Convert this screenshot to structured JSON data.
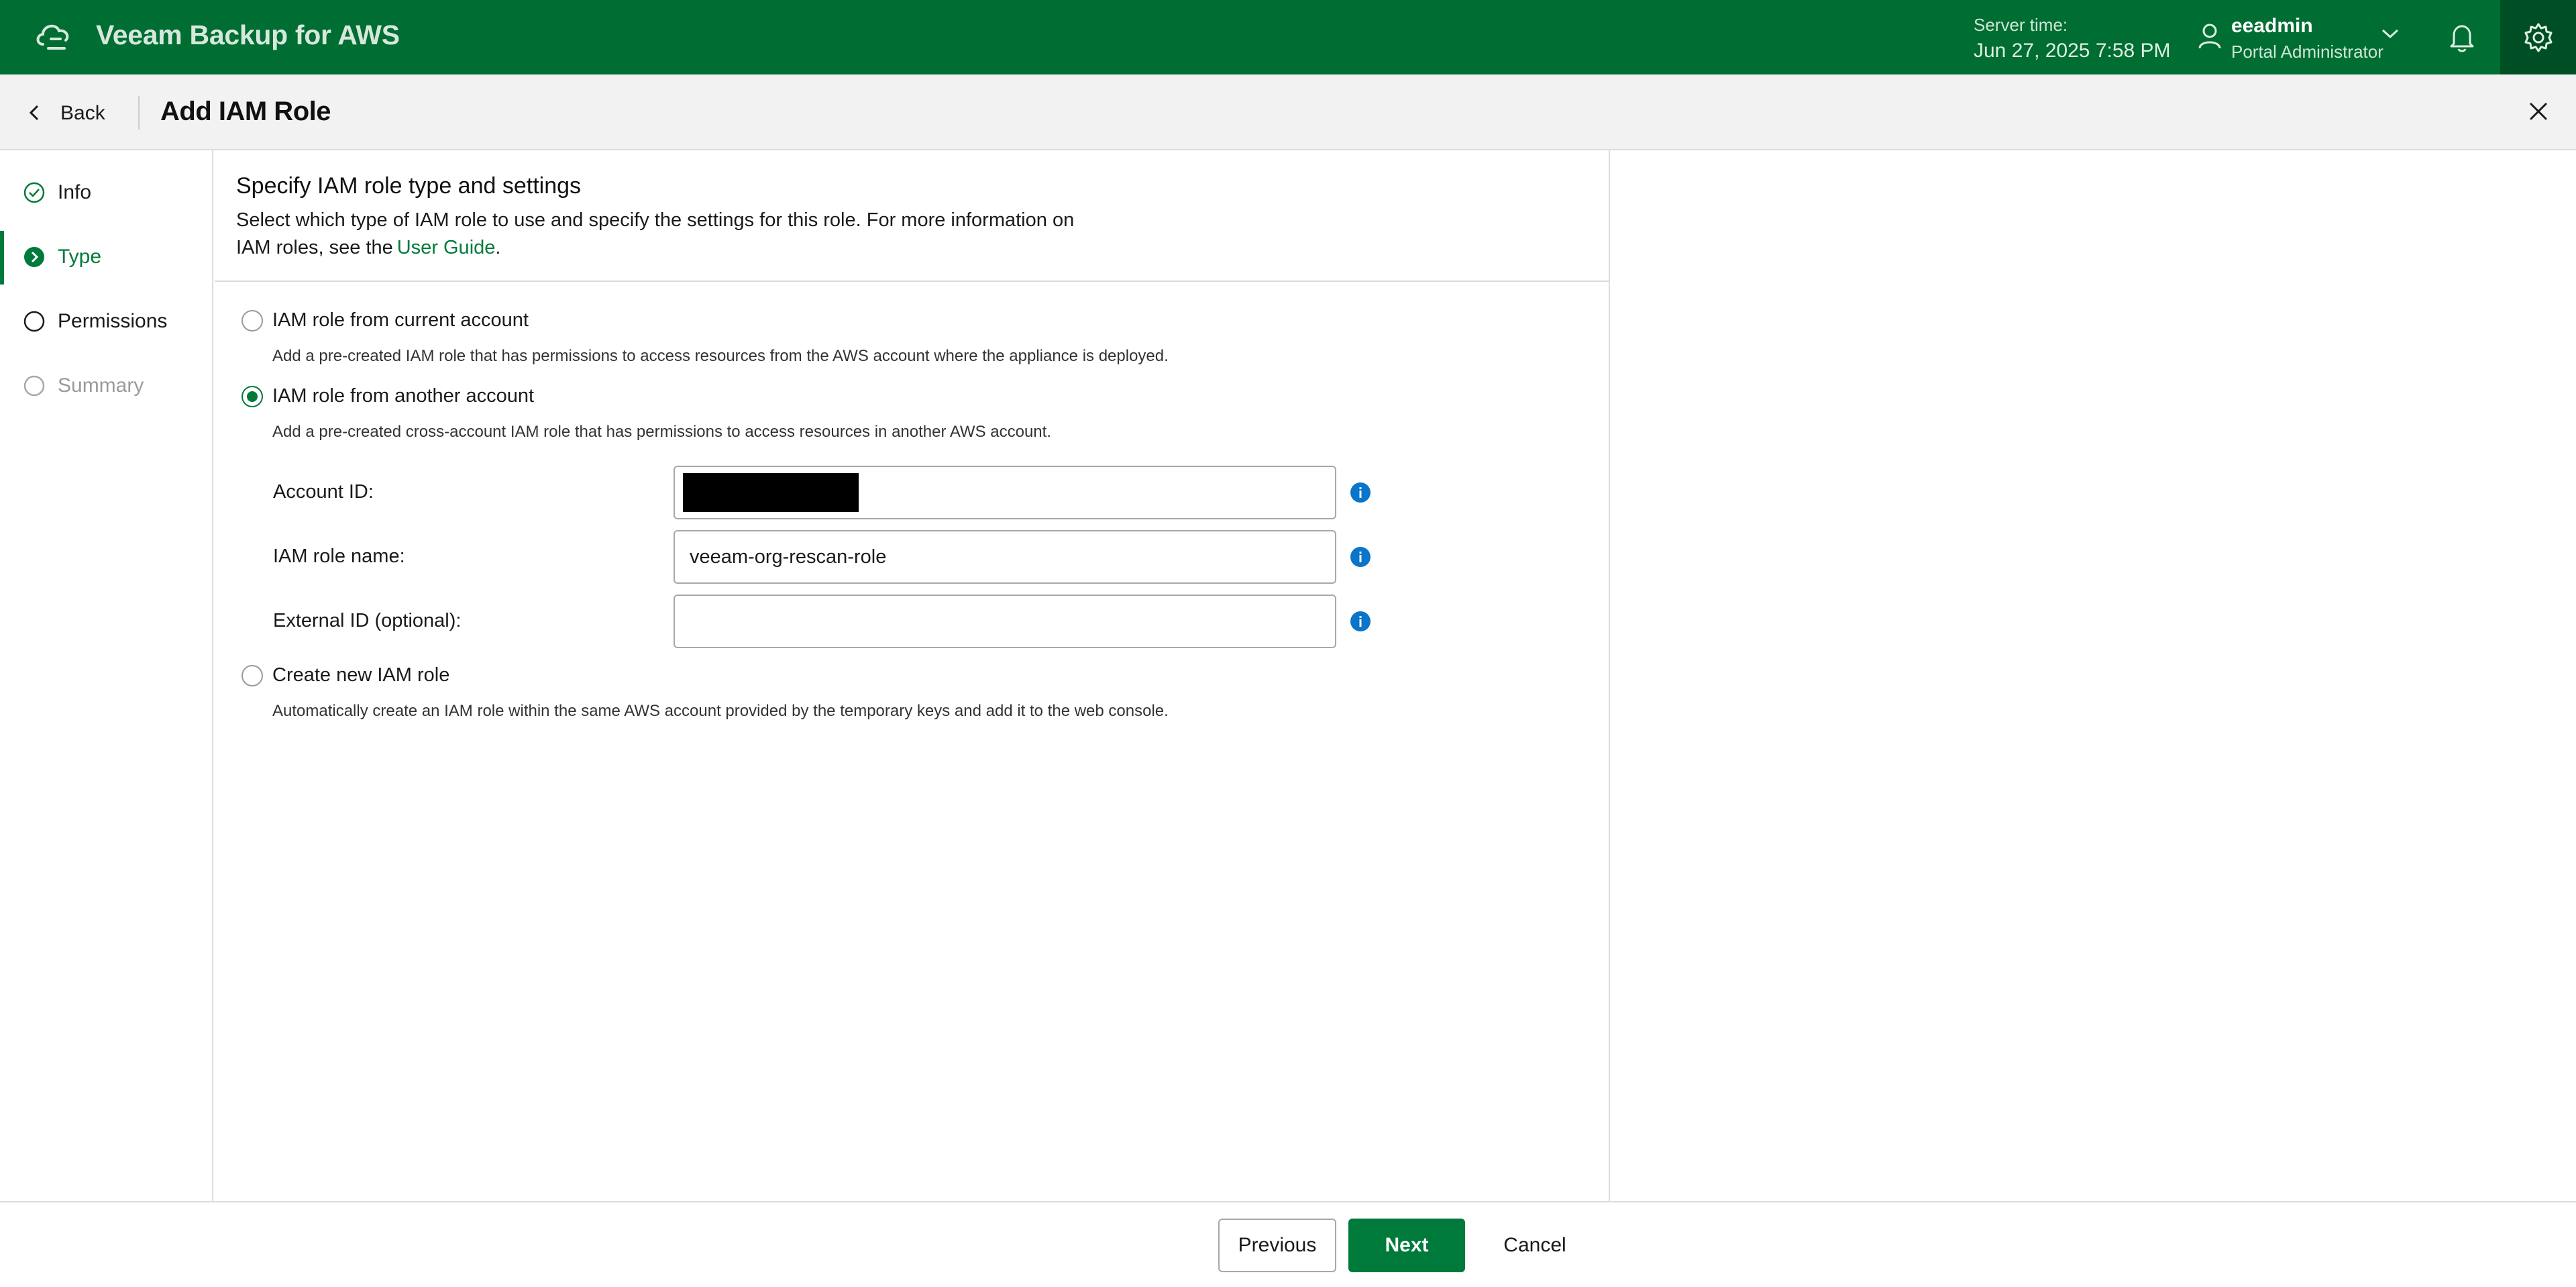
{
  "topbar": {
    "app_title": "Veeam Backup for AWS",
    "server_time_label": "Server time:",
    "server_time_value": "Jun 27, 2025 7:58 PM",
    "user_name": "eeadmin",
    "user_role": "Portal Administrator",
    "accent_color": "#006d32"
  },
  "header": {
    "back_label": "Back",
    "title": "Add IAM Role"
  },
  "steps": [
    {
      "label": "Info",
      "state": "completed"
    },
    {
      "label": "Type",
      "state": "active"
    },
    {
      "label": "Permissions",
      "state": "pending"
    },
    {
      "label": "Summary",
      "state": "disabled"
    }
  ],
  "section": {
    "title": "Specify IAM role type and settings",
    "description": "Select which type of IAM role to use and specify the settings for this role. For more information on IAM roles, see the",
    "link_text": "User Guide",
    "description_end": "."
  },
  "options": [
    {
      "label": "IAM role from current account",
      "description": "Add a pre-created IAM role that has permissions to access resources from the AWS account where the appliance is deployed.",
      "selected": false
    },
    {
      "label": "IAM role from another account",
      "description": "Add a pre-created cross-account IAM role that has permissions to access resources in another AWS account.",
      "selected": true
    },
    {
      "label": "Create new IAM role",
      "description": "Automatically create an IAM role within the same AWS account provided by the temporary keys and add it to the web console.",
      "selected": false
    }
  ],
  "fields": {
    "account_id_label": "Account ID:",
    "account_id_value": "",
    "iam_role_name_label": "IAM role name:",
    "iam_role_name_value": "veeam-org-rescan-role",
    "external_id_label": "External ID (optional):",
    "external_id_value": ""
  },
  "footer": {
    "previous_label": "Previous",
    "next_label": "Next",
    "cancel_label": "Cancel"
  }
}
